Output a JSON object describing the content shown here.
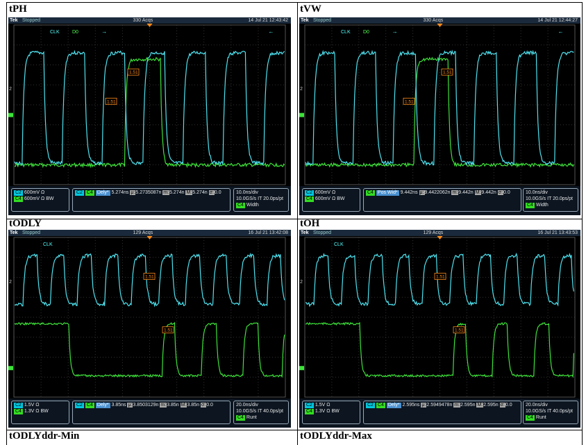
{
  "cells": [
    {
      "title": "tPH",
      "topbar": {
        "brand": "Tek",
        "state": "Stopped",
        "acqs": "330 Acqs",
        "time": "14 Jul 21 12:43:42"
      },
      "labels": {
        "clk": "CLK",
        "d0": "D0",
        "cursor": "1.51"
      },
      "panel": {
        "ch_c2": "C2",
        "ch_c4": "C4",
        "c2_scale": "600mV Ω",
        "c4_scale": "600mV Ω",
        "c4_bw": "BW",
        "meas_c2": "C2",
        "meas_c4": "C4",
        "meas_name": "Dely*",
        "meas_val": "5.274ns",
        "mu": "μ:",
        "mu_val": "5.2735087n",
        "m": "m:",
        "m_val": "5.274n",
        "M": "M:",
        "M_val": "5.274n",
        "sigma": "σ:",
        "sigma_val": "0.0",
        "tb1": "10.0ns/div",
        "tb2": "10.0GS/s IT 20.0ps/pt",
        "trig_ch": "C4",
        "trig_type": "Width"
      }
    },
    {
      "title": "tVW",
      "topbar": {
        "brand": "Tek",
        "state": "Stopped",
        "acqs": "330 Acqs",
        "time": "14 Jul 21 12:44:27"
      },
      "labels": {
        "clk": "CLK",
        "d0": "D0",
        "cursor": "1.51"
      },
      "panel": {
        "ch_c2": "C2",
        "ch_c4": "C4",
        "c2_scale": "600mV Ω",
        "c4_scale": "600mV Ω",
        "c4_bw": "BW",
        "meas_c2": "",
        "meas_c4": "C4",
        "meas_name": "Pos Wid*",
        "meas_val": "9.442ns",
        "mu": "μ:",
        "mu_val": "9.4422062n",
        "m": "m:",
        "m_val": "9.442n",
        "M": "M:",
        "M_val": "9.442n",
        "sigma": "σ:",
        "sigma_val": "0.0",
        "tb1": "10.0ns/div",
        "tb2": "10.0GS/s IT 20.0ps/pt",
        "trig_ch": "C4",
        "trig_type": "Width"
      }
    },
    {
      "title": "tODLY",
      "topbar": {
        "brand": "Tek",
        "state": "Stopped",
        "acqs": "129 Acqs",
        "time": "16 Jul 21 13:42:08"
      },
      "labels": {
        "clk": "CLK",
        "d0": "",
        "cursor": "1.51"
      },
      "panel": {
        "ch_c2": "C2",
        "ch_c4": "C4",
        "c2_scale": "1.5V Ω",
        "c4_scale": "1.3V Ω",
        "c4_bw": "BW",
        "meas_c2": "C2",
        "meas_c4": "C4",
        "meas_name": "Dely*",
        "meas_val": "3.85ns",
        "mu": "μ:",
        "mu_val": "3.8503129n",
        "m": "m:",
        "m_val": "3.85n",
        "M": "M:",
        "M_val": "3.85n",
        "sigma": "σ:",
        "sigma_val": "0.0",
        "tb1": "20.0ns/div",
        "tb2": "10.0GS/s IT 40.0ps/pt",
        "trig_ch": "C4",
        "trig_type": "Runt"
      }
    },
    {
      "title": "tOH",
      "topbar": {
        "brand": "Tek",
        "state": "Stopped",
        "acqs": "129 Acqs",
        "time": "16 Jul 21 13:43:53"
      },
      "labels": {
        "clk": "CLK",
        "d0": "",
        "cursor": "1.51"
      },
      "panel": {
        "ch_c2": "C2",
        "ch_c4": "C4",
        "c2_scale": "1.5V Ω",
        "c4_scale": "1.3V Ω",
        "c4_bw": "BW",
        "meas_c2": "C2",
        "meas_c4": "C4",
        "meas_name": "Dely*",
        "meas_val": "2.595ns",
        "mu": "μ:",
        "mu_val": "2.5949478n",
        "m": "m:",
        "m_val": "2.595n",
        "M": "M:",
        "M_val": "2.595n",
        "sigma": "σ:",
        "sigma_val": "0.0",
        "tb1": "20.0ns/div",
        "tb2": "10.0GS/s IT 40.0ps/pt",
        "trig_ch": "C4",
        "trig_type": "Runt"
      }
    }
  ],
  "bottom_titles": [
    "tODLYddr-Min",
    "tODLYddr-Max"
  ],
  "colors": {
    "clk": "#4fe3f0",
    "data": "#3ee23a",
    "panel": "#0c1520",
    "cursor": "#ff8c1a"
  }
}
